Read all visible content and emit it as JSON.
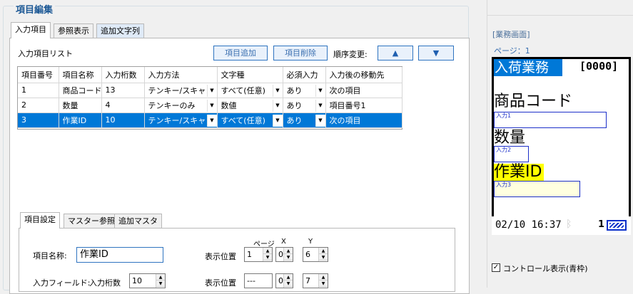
{
  "group_title": "項目編集",
  "tabs": [
    "入力項目",
    "参照表示",
    "追加文字列"
  ],
  "list": {
    "title": "入力項目リスト",
    "add_button": "項目追加",
    "delete_button": "項目削除",
    "order_label": "順序変更:",
    "up_arrow": "▲",
    "down_arrow": "▼",
    "columns": [
      "項目番号",
      "項目名称",
      "入力桁数",
      "入力方法",
      "文字種",
      "必須入力",
      "入力後の移動先"
    ],
    "rows": [
      [
        "1",
        "商品コード",
        "13",
        "テンキー/スキャン",
        "すべて(任意)",
        "あり",
        "次の項目"
      ],
      [
        "2",
        "数量",
        "4",
        "テンキーのみ",
        "数値",
        "あり",
        "項目番号1"
      ],
      [
        "3",
        "作業ID",
        "10",
        "テンキー/スキャン",
        "すべて(任意)",
        "あり",
        "次の項目"
      ]
    ]
  },
  "sub_tabs": [
    "項目設定",
    "マスター参照",
    "追加マスタ"
  ],
  "settings": {
    "item_name_label": "項目名称:",
    "item_name_value": "作業ID",
    "display_pos_label": "表示位置",
    "col_page": "ページ",
    "col_x": "X",
    "col_y": "Y",
    "pos1": {
      "page": "1",
      "x": "0",
      "y": "6"
    },
    "input_field_label": "入力フィールド:",
    "digits_label": "入力桁数",
    "digits_value": "10",
    "display_pos2_label": "表示位置",
    "pos2": {
      "page": "---",
      "x": "0",
      "y": "7"
    }
  },
  "preview": {
    "section_label": "[業務画面]",
    "page_label": "ページ：1",
    "title": "入荷業務",
    "counter": "[0000]",
    "item1": "商品コード",
    "input1": "入力1",
    "item2": "数量",
    "input2": "入力2",
    "item3": "作業ID",
    "input3": "入力3",
    "status_time": "02/10 16:37",
    "status_num": "1"
  },
  "control_display": {
    "label": "コントロール表示(青枠)",
    "checked": true
  }
}
